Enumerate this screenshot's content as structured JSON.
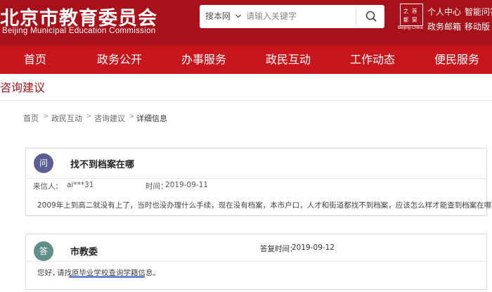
{
  "header": {
    "logo_cn": "北京市教育委员会",
    "logo_en": "Beijing Municipal Education Commission",
    "search": {
      "scope_label": "搜本网",
      "placeholder": "请输入关键字"
    },
    "seal_text": "Beijing·China",
    "links": [
      "个人中心",
      "智能问答",
      "政务邮箱",
      "移动版"
    ]
  },
  "nav": {
    "items": [
      "首页",
      "政务公开",
      "办事服务",
      "政民互动",
      "工作动态",
      "便民服务"
    ]
  },
  "page": {
    "title": "咨询建议"
  },
  "breadcrumb": [
    "首页",
    "政民互动",
    "咨询建议",
    "详细信息"
  ],
  "question": {
    "avatar_label": "问",
    "title": "找不到档案在哪",
    "sender_label": "来信人：",
    "sender": "ai***31",
    "time_label": "时间：",
    "time": "2019-09-11",
    "body": "2009年上到高二就没有上了，当时也没办理什么手续，现在没有档案，本市户口，人才和街道都找不到档案，应该怎么样才能查到档案在哪里？"
  },
  "answer": {
    "avatar_label": "答",
    "responder": "市教委",
    "time_label": "答复时间：",
    "time": "2019-09-12",
    "greeting": "您好，",
    "body": "请找原毕业学校查询学籍信息。"
  },
  "colors": {
    "brand_red": "#a8111a",
    "nav_red": "#c8161d",
    "question_avatar": "#5b5f95",
    "answer_avatar": "#5f8f86",
    "annotation_underline": "#6d86d6"
  },
  "icons": {
    "search": "search-icon",
    "dropdown": "chevron-down-icon",
    "seal": "seal-logo"
  }
}
